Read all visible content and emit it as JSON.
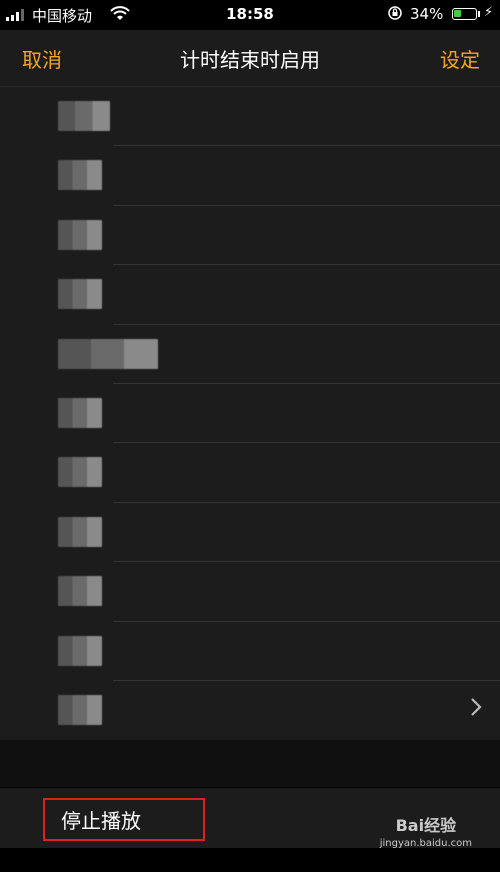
{
  "status_bar": {
    "carrier": "中国移动",
    "time": "18:58",
    "battery_percent": "34%",
    "battery_level": 0.34,
    "signal_icon": "signal-bars-icon",
    "wifi_icon": "wifi-icon",
    "orientation_lock_icon": "orientation-lock-icon",
    "charging_icon": "charging-bolt-icon"
  },
  "nav": {
    "cancel": "取消",
    "title": "计时结束时启用",
    "set": "设定"
  },
  "list": {
    "items": [
      {
        "label": ""
      },
      {
        "label": ""
      },
      {
        "label": ""
      },
      {
        "label": ""
      },
      {
        "label": ""
      },
      {
        "label": ""
      },
      {
        "label": ""
      },
      {
        "label": ""
      },
      {
        "label": ""
      },
      {
        "label": ""
      },
      {
        "label": "",
        "has_chevron": true
      }
    ]
  },
  "stop": {
    "label": "停止播放"
  },
  "watermark": {
    "brand": "Bai经验",
    "url": "jingyan.baidu.com"
  },
  "colors": {
    "accent": "#f5a623",
    "highlight": "#e02020",
    "background": "#1c1c1c"
  }
}
